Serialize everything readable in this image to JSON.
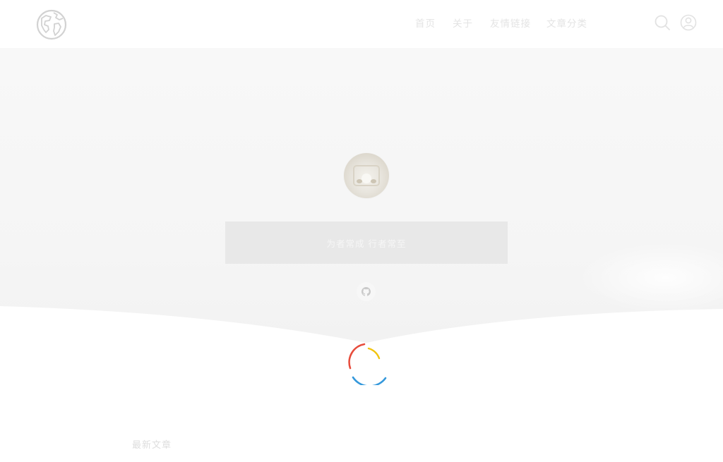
{
  "header": {
    "logo_icon": "globe-icon",
    "nav": [
      {
        "label": "首页"
      },
      {
        "label": "关于"
      },
      {
        "label": "友情链接"
      },
      {
        "label": "文章分类"
      }
    ],
    "search_icon": "search-icon",
    "user_icon": "user-icon"
  },
  "hero": {
    "avatar_icon": "avatar",
    "motto": "为者常成 行者常至",
    "social_icon": "github-icon"
  },
  "loader": {
    "icon": "loading-spinner-icon",
    "colors": [
      "#e74c3c",
      "#f1c40f",
      "#3498db"
    ]
  },
  "section": {
    "title": "最新文章"
  },
  "colors": {
    "header_bg": "#ffffff",
    "nav_text": "#e4e4e4",
    "motto_box": "#e8e8e8"
  }
}
